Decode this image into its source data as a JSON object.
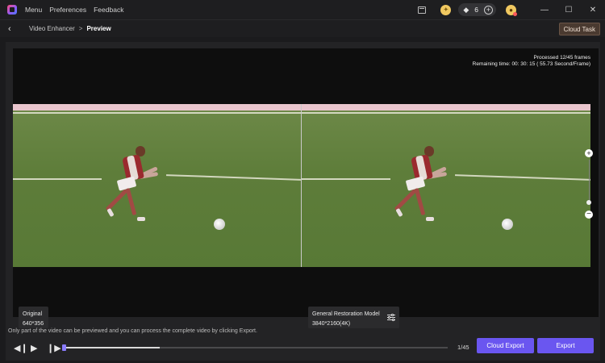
{
  "menu": {
    "items": [
      "Menu",
      "Preferences",
      "Feedback"
    ]
  },
  "account": {
    "credit_count": "6"
  },
  "breadcrumb": {
    "parent": "Video Enhancer",
    "separator": ">",
    "current": "Preview"
  },
  "cloud_task_label": "Cloud Task",
  "progress": {
    "processed": "Processed 12/45 frames",
    "remaining": "Remaining time: 00: 30: 15 ( 55.73 Second/Frame)"
  },
  "original": {
    "title": "Original",
    "resolution": "640*356"
  },
  "model": {
    "title": "General Restoration Model",
    "resolution": "3840*2160(4K)"
  },
  "notice": "Only part of the video can be previewed and you can process the complete video by clicking Export.",
  "playback": {
    "frame_counter": "1/45",
    "progress_fraction": 0.25
  },
  "buttons": {
    "cloud_export": "Cloud Export",
    "export": "Export"
  },
  "icons": {
    "logo": "app-logo-icon",
    "task": "task-list-icon",
    "coin": "coin-icon",
    "diamond": "diamond-icon",
    "plus": "plus-icon",
    "user": "user-icon",
    "minimize": "minimize-icon",
    "maximize": "maximize-icon",
    "close": "close-icon",
    "back": "chevron-left-icon",
    "zoom_in": "zoom-in-icon",
    "zoom_out": "zoom-out-icon",
    "settings": "sliders-icon",
    "prev": "previous-frame-icon",
    "play": "play-icon",
    "next": "next-frame-icon"
  },
  "colors": {
    "accent": "#6a56f0",
    "cloud_task_bg": "#4a3a30",
    "pitch": "#5e7c3b"
  }
}
